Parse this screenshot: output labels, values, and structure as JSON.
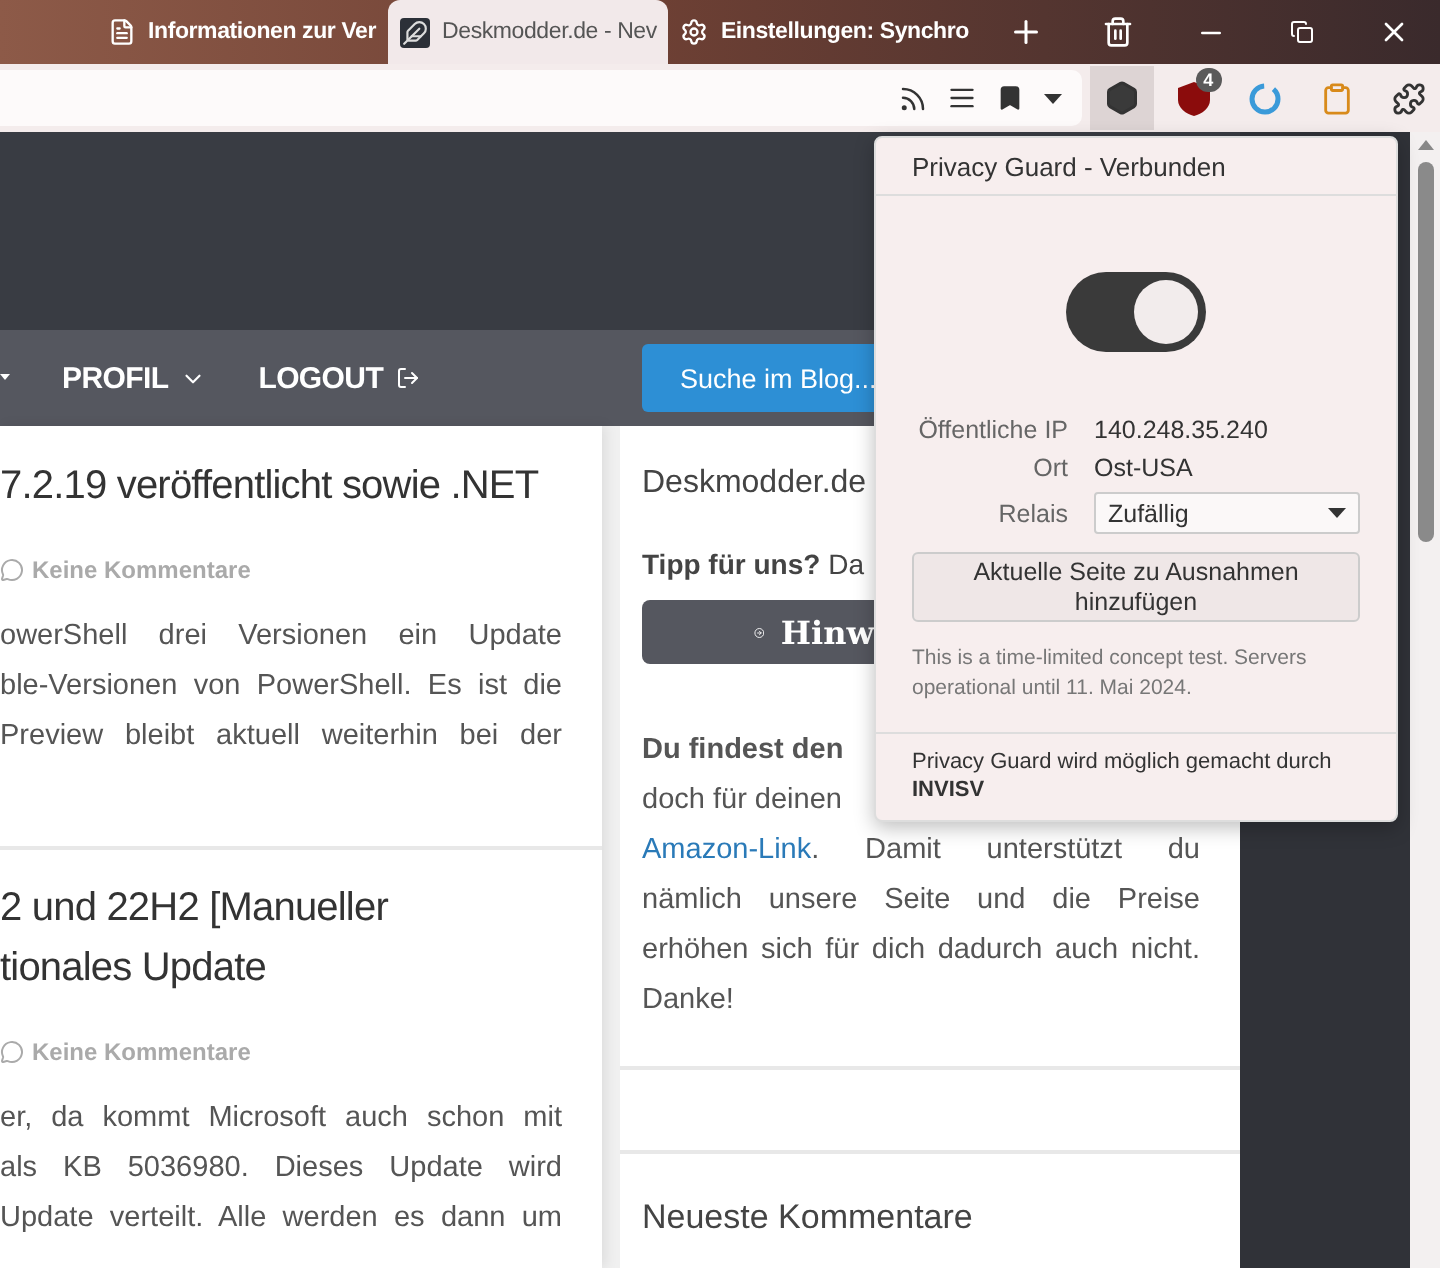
{
  "browser": {
    "tabs": [
      {
        "title": "Informationen zur Ver",
        "kind": "page",
        "selected": false
      },
      {
        "title": "Deskmodder.de - Nev",
        "kind": "feather",
        "selected": true
      },
      {
        "title": "Einstellungen: Synchro",
        "kind": "settings",
        "selected": false
      }
    ],
    "privacy_guard_active": true,
    "ublock_badge": "4"
  },
  "site": {
    "nav": [
      {
        "label": "PROFIL",
        "kind": "menu"
      },
      {
        "label": "LOGOUT",
        "kind": "logout"
      }
    ],
    "search_button": "Suche im Blog...",
    "articles": [
      {
        "title_lines": [
          "7.2.19 veröffentlicht sowie .NET"
        ],
        "meta": "Keine Kommentare",
        "body_lines": [
          "owerShell drei Versionen ein Update",
          "ble-Versionen von PowerShell. Es ist die",
          "Preview bleibt aktuell weiterhin bei der"
        ]
      },
      {
        "title_lines": [
          "2 und 22H2 [Manueller",
          "tionales Update"
        ],
        "meta": "Keine Kommentare",
        "body_lines": [
          "er, da kommt Microsoft auch schon mit",
          "als KB 5036980. Dieses Update wird",
          "Update verteilt. Alle werden es dann um"
        ]
      }
    ],
    "sidebar": {
      "heading": "Deskmodder.de",
      "tip": "**Tipp für uns?** Da",
      "button": "Hinw",
      "promo_lines": [
        {
          "text": "Du findest den",
          "kind": "bold"
        },
        {
          "text": "doch für deinen",
          "kind": "plain"
        },
        {
          "link": "Amazon-Link",
          "text": ". Damit unterstützt du",
          "kind": "link"
        },
        {
          "text": "nämlich unsere Seite und die Preise",
          "kind": "justify"
        },
        {
          "text": "erhöhen sich für dich dadurch auch nicht.",
          "kind": "justify"
        },
        {
          "text": "Danke!",
          "kind": "plain"
        }
      ],
      "widget_title": "Neueste Kommentare"
    }
  },
  "popup": {
    "title": "Privacy Guard - Verbunden",
    "on": true,
    "rows": [
      {
        "label": "Öffentliche IP",
        "value": "140.248.35.240",
        "kind": "text"
      },
      {
        "label": "Ort",
        "value": "Ost-USA",
        "kind": "text"
      },
      {
        "label": "Relais",
        "value": "Zufällig",
        "kind": "select"
      }
    ],
    "action_button": "Aktuelle Seite zu Ausnahmen hinzufügen",
    "note": "This is a time-limited concept test. Servers operational until 11. Mai 2024.",
    "footer": "Privacy Guard wird möglich gemacht durch **INVISV**"
  }
}
